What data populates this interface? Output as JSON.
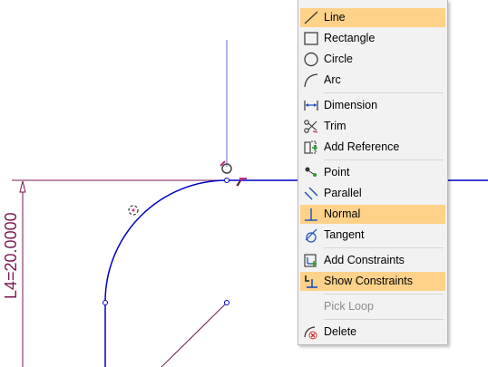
{
  "canvas": {
    "dimension_label": "L4=20.0000",
    "colors": {
      "geometry": "#0000c8",
      "dimension": "#7a1850",
      "construction": "#6a6ae0",
      "accent": "#c0307a"
    }
  },
  "context_menu": {
    "items": [
      {
        "label": "Line",
        "icon": "line-icon",
        "highlighted": true
      },
      {
        "label": "Rectangle",
        "icon": "rectangle-icon"
      },
      {
        "label": "Circle",
        "icon": "circle-icon"
      },
      {
        "label": "Arc",
        "icon": "arc-icon"
      },
      {
        "label": "Dimension",
        "icon": "dimension-icon"
      },
      {
        "label": "Trim",
        "icon": "trim-icon"
      },
      {
        "label": "Add Reference",
        "icon": "add-reference-icon"
      },
      {
        "label": "Point",
        "icon": "point-icon"
      },
      {
        "label": "Parallel",
        "icon": "parallel-icon"
      },
      {
        "label": "Normal",
        "icon": "normal-icon",
        "highlighted": true
      },
      {
        "label": "Tangent",
        "icon": "tangent-icon"
      },
      {
        "label": "Add Constraints",
        "icon": "add-constraints-icon"
      },
      {
        "label": "Show Constraints",
        "icon": "show-constraints-icon",
        "highlighted": true
      },
      {
        "label": "Pick Loop",
        "icon": "",
        "disabled": true
      },
      {
        "label": "Delete",
        "icon": "delete-icon"
      }
    ],
    "highlight_color": "#ffd28a"
  }
}
